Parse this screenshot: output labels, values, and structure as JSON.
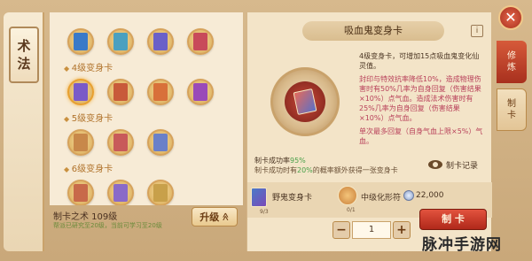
{
  "left_tab": {
    "chars": [
      "术",
      "法"
    ]
  },
  "card_list": {
    "row0": [
      {
        "color": "#3a7ac8"
      },
      {
        "color": "#4aa0c0"
      },
      {
        "color": "#6a60c8"
      },
      {
        "color": "#c84a5a"
      }
    ],
    "section1": "4级变身卡",
    "row1": [
      {
        "color": "#7a5ac8"
      },
      {
        "color": "#c85a3a"
      },
      {
        "color": "#d8703a"
      },
      {
        "color": "#9a4ab8"
      }
    ],
    "section2": "5级变身卡",
    "row2": [
      {
        "color": "#c8884a"
      },
      {
        "color": "#c85a5a"
      },
      {
        "color": "#6a80c8"
      }
    ],
    "section3": "6级变身卡",
    "row3": [
      {
        "color": "#c86a4a"
      },
      {
        "color": "#8a6ac8"
      },
      {
        "color": "#c8a04a"
      }
    ]
  },
  "level": {
    "title": "制卡之术 109级",
    "sub": "帮派已研究至20级，当前可学习至20级",
    "upgrade_label": "升级",
    "upgrade_icon": "≪"
  },
  "detail": {
    "title": "吸血鬼变身卡",
    "help": "i",
    "desc": [
      "4级变身卡，可增加15点吸血鬼变化仙灵值。",
      "封印与特效抗率降低10%，造成物理伤害时有50%几率为自身回复（伤害结果×10%）点气血。造成法术伤害时有25%几率为自身回复（伤害结果×10%）点气血。",
      "单次最多回复（自身气血上限×5%）气血。"
    ],
    "rate_label": "制卡成功率",
    "rate_value": "95%",
    "rate_sub_pre": "制卡成功时有",
    "rate_sub_pct": "20%",
    "rate_sub_post": "的概率额外获得一张变身卡",
    "record_label": "制卡记录"
  },
  "materials": {
    "mat1_label": "野鬼变身卡",
    "mat1_count": "9/3",
    "mat2_count": "0/1",
    "mat2_label": "中级化形符",
    "coin_value": "22,000"
  },
  "quantity": {
    "minus": "−",
    "value": "1",
    "plus": "+"
  },
  "make_label": "制 卡",
  "right_tabs": {
    "tab1": [
      "修",
      "炼"
    ],
    "tab2": [
      "制",
      "卡"
    ]
  },
  "close": "✕",
  "watermark": "脉冲手游网"
}
